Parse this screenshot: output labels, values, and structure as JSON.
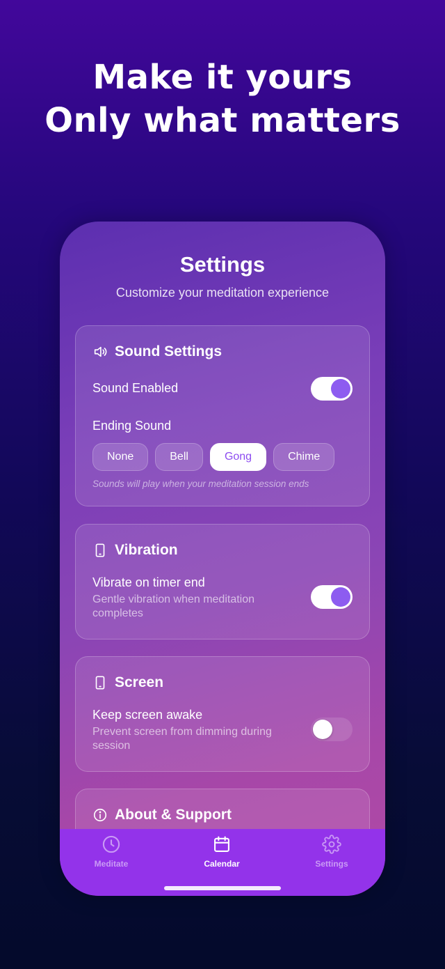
{
  "headline": {
    "line1": "Make it yours",
    "line2": "Only what matters"
  },
  "screen": {
    "title": "Settings",
    "subtitle": "Customize your meditation experience"
  },
  "sound": {
    "header": "Sound Settings",
    "header_icon": "speaker-icon",
    "enabled_label": "Sound Enabled",
    "enabled": true,
    "ending_label": "Ending Sound",
    "options": [
      "None",
      "Bell",
      "Gong",
      "Chime"
    ],
    "selected": "Gong",
    "hint": "Sounds will play when your meditation session ends"
  },
  "vibration": {
    "header": "Vibration",
    "header_icon": "phone-icon",
    "label": "Vibrate on timer end",
    "sub_line1": "Gentle vibration when meditation",
    "sub_line2": "completes",
    "enabled": true
  },
  "screen_settings": {
    "header": "Screen",
    "header_icon": "phone-icon",
    "label": "Keep screen awake",
    "sub_line1": "Prevent screen from dimming during",
    "sub_line2": "session",
    "enabled": false
  },
  "about": {
    "header": "About & Support",
    "header_icon": "info-icon"
  },
  "tabs": [
    {
      "label": "Meditate",
      "icon": "clock-icon",
      "active": false
    },
    {
      "label": "Calendar",
      "icon": "calendar-icon",
      "active": true
    },
    {
      "label": "Settings",
      "icon": "gear-icon",
      "active": false
    }
  ],
  "colors": {
    "accent": "#8d5cf0",
    "tabbar": "#9333ea"
  }
}
